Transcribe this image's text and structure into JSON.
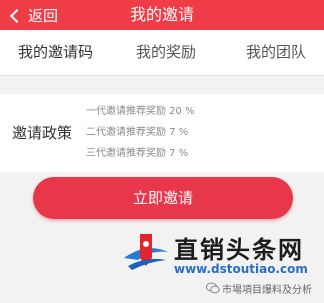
{
  "header": {
    "back_label": "返回",
    "title": "我的邀请"
  },
  "tabs": [
    {
      "label": "我的邀请码",
      "active": true
    },
    {
      "label": "我的奖励",
      "active": false
    },
    {
      "label": "我的团队",
      "active": false
    }
  ],
  "policy": {
    "label": "邀请政策",
    "lines": [
      "一代邀请推荐奖励 20 %",
      "二代邀请推荐奖励 7 %",
      "三代邀请推荐奖励 7 %"
    ]
  },
  "invite_button": {
    "label": "立即邀请"
  },
  "watermark": {
    "name": "直销头条网",
    "url": "www.dstoutiao.com",
    "account": "市場項目爆料及分析"
  },
  "colors": {
    "accent": "#f03c46",
    "button": "#e8364a",
    "background": "#f2f2f2"
  }
}
